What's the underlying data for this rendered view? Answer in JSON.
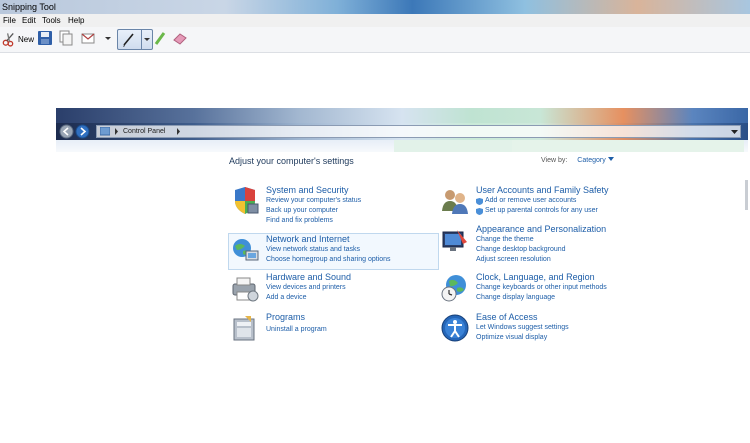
{
  "app": {
    "title": "Snipping Tool"
  },
  "menu": [
    "File",
    "Edit",
    "Tools",
    "Help"
  ],
  "toolbar": {
    "new_label": "New"
  },
  "control_panel": {
    "breadcrumb": "Control Panel",
    "heading": "Adjust your computer's settings",
    "view_by_label": "View by:",
    "view_by_value": "Category",
    "left_items": [
      {
        "title": "System and Security",
        "icon": "shield-pc-icon",
        "links": [
          "Review your computer's status",
          "Back up your computer",
          "Find and fix problems"
        ]
      },
      {
        "title": "Network and Internet",
        "icon": "network-globe-icon",
        "links": [
          "View network status and tasks",
          "Choose homegroup and sharing options"
        ]
      },
      {
        "title": "Hardware and Sound",
        "icon": "printer-icon",
        "links": [
          "View devices and printers",
          "Add a device"
        ]
      },
      {
        "title": "Programs",
        "icon": "programs-icon",
        "links": [
          "Uninstall a program"
        ]
      }
    ],
    "right_items": [
      {
        "title": "User Accounts and Family Safety",
        "icon": "users-icon",
        "links": [
          "Add or remove user accounts",
          "Set up parental controls for any user"
        ]
      },
      {
        "title": "Appearance and Personalization",
        "icon": "display-icon",
        "links": [
          "Change the theme",
          "Change desktop background",
          "Adjust screen resolution"
        ]
      },
      {
        "title": "Clock, Language, and Region",
        "icon": "clock-globe-icon",
        "links": [
          "Change keyboards or other input methods",
          "Change display language"
        ]
      },
      {
        "title": "Ease of Access",
        "icon": "ease-of-access-icon",
        "links": [
          "Let Windows suggest settings",
          "Optimize visual display"
        ]
      }
    ]
  }
}
